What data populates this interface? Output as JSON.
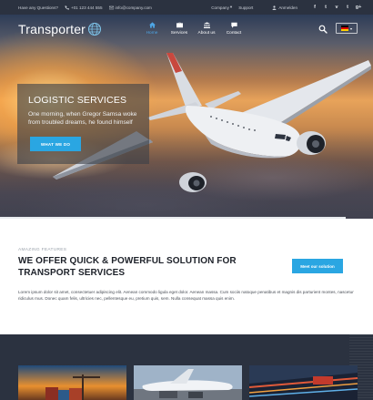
{
  "topbar": {
    "question": "Have any Questions?",
    "phone": "+01 123 444 555",
    "email": "info@company.com",
    "company_menu": "Company",
    "support": "Support",
    "account": "Anmelden",
    "social_icons": [
      "facebook-icon",
      "twitter-icon",
      "vimeo-icon",
      "tumblr-icon",
      "google-plus-icon"
    ],
    "social_glyphs": [
      "f",
      "t",
      "v",
      "t",
      "g+"
    ]
  },
  "brand": {
    "name": "Transporter"
  },
  "nav": {
    "items": [
      {
        "label": "Home",
        "icon": "home-icon",
        "active": true
      },
      {
        "label": "Services",
        "icon": "briefcase-icon",
        "active": false
      },
      {
        "label": "About us",
        "icon": "bank-icon",
        "active": false
      },
      {
        "label": "Contact",
        "icon": "chat-icon",
        "active": false
      }
    ]
  },
  "language": {
    "selected": "DE",
    "flag_colors": [
      "#000000",
      "#dd0000",
      "#ffce00"
    ]
  },
  "hero": {
    "title": "LOGISTIC SERVICES",
    "text": "One morning, when Gregor Samsa woke from troubled dreams, he found himself",
    "button": "WHAT WE DO"
  },
  "features": {
    "label": "AMAZING FEATURES",
    "title": "WE OFFER QUICK & POWERFUL SOLUTION FOR TRANSPORT SERVICES",
    "button": "Meet our solution",
    "body": "Lorem ipsum dolor sit amet, consectetuer adipiscing elit. Aenean commodo ligula eget dolor. Aenean massa. Cum sociis natoque penatibus et magnis dis parturient montes, nascetur ridiculus mus. Donec quam felis, ultricies nec, pellentesque eu, pretium quis, sem. Nulla consequat massa quis enim."
  },
  "colors": {
    "accent": "#2aa6e2",
    "topbar": "#2b3240",
    "active_nav": "#4ea6e6"
  }
}
